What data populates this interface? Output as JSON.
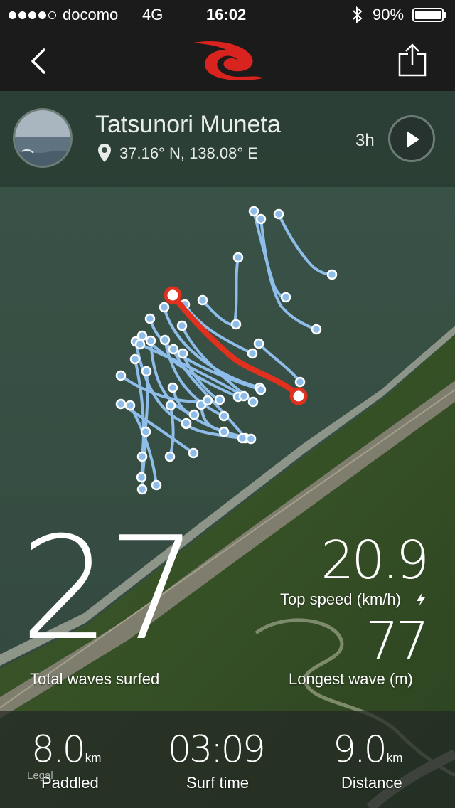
{
  "status_bar": {
    "carrier": "docomo",
    "network": "4G",
    "time": "16:02",
    "battery": "90%",
    "signal_dots": 4,
    "battery_level": 0.9
  },
  "nav": {
    "back_icon": "chevron-left-icon",
    "logo_icon": "rip-curl-logo",
    "share_icon": "share-icon"
  },
  "profile": {
    "name": "Tatsunori Muneta",
    "location": "37.16° N, 138.08° E",
    "time_ago": "3h",
    "play_icon": "play-icon"
  },
  "stats": {
    "total_waves": "27",
    "total_waves_label": "Total waves surfed",
    "top_speed": "20.9",
    "top_speed_label": "Top speed (km/h)",
    "longest_wave": "77",
    "longest_wave_label": "Longest wave (m)"
  },
  "summary": {
    "paddled_value": "8.0",
    "paddled_unit": "km",
    "paddled_label": "Paddled",
    "surf_time_value": "03:09",
    "surf_time_label": "Surf time",
    "distance_value": "9.0",
    "distance_unit": "km",
    "distance_label": "Distance"
  },
  "map": {
    "legal": "Legal"
  },
  "colors": {
    "track": "#8dbde8",
    "highlight_track": "#e0301e",
    "brand_red": "#d8231e"
  }
}
